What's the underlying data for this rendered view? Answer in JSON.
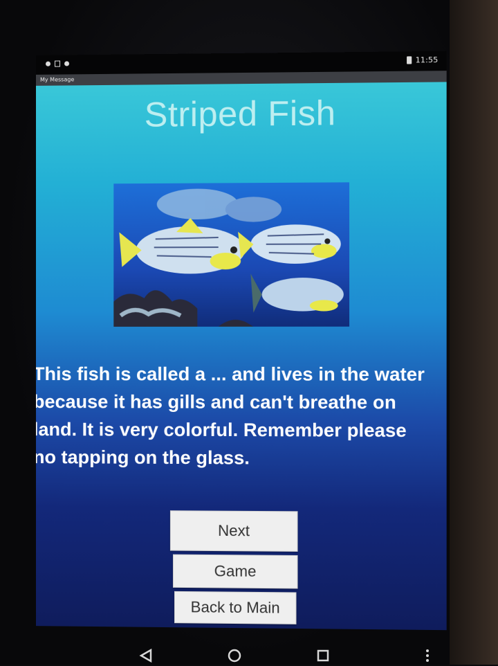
{
  "status_bar": {
    "time": "11:55",
    "icons": [
      "notification-dot-icon",
      "screenshot-icon",
      "notification-dot-icon",
      "battery-icon"
    ]
  },
  "action_bar": {
    "app_title": "My Message"
  },
  "page": {
    "title": "Striped Fish",
    "image_alt_icon": "fish-photo",
    "description": "This fish is called a ... and lives in the water because it has gills and can't breathe on land. It is very colorful. Remember please no tapping on the glass."
  },
  "buttons": {
    "next_label": "Next",
    "game_label": "Game",
    "back_label": "Back to Main"
  },
  "nav_bar": {
    "icons": [
      "back-icon",
      "home-icon",
      "recents-icon",
      "menu-icon"
    ]
  },
  "colors": {
    "gradient_top": "#39c7d8",
    "gradient_bottom": "#0f1c5c",
    "title_text": "#bdeef0",
    "body_text": "#ffffff",
    "button_bg": "#efefef"
  }
}
